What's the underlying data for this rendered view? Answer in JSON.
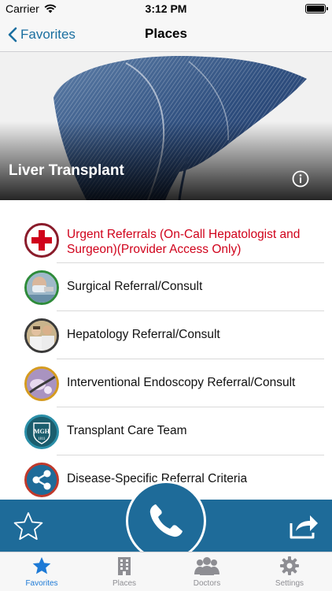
{
  "status_bar": {
    "carrier": "Carrier",
    "time": "3:12 PM"
  },
  "nav": {
    "back_label": "Favorites",
    "title": "Places"
  },
  "hero": {
    "title": "Liver Transplant"
  },
  "list": {
    "items": [
      {
        "label": "Urgent Referrals (On-Call Hepatologist and Surgeon)(Provider Access Only)",
        "icon": "red-cross-icon",
        "urgent": true
      },
      {
        "label": "Surgical Referral/Consult",
        "icon": "surgeon-photo"
      },
      {
        "label": "Hepatology Referral/Consult",
        "icon": "doctors-photo"
      },
      {
        "label": "Interventional Endoscopy Referral/Consult",
        "icon": "endoscopy-photo"
      },
      {
        "label": "Transplant Care Team",
        "icon": "mgh-logo"
      },
      {
        "label": "Disease-Specific Referral Criteria",
        "icon": "share-network-icon"
      }
    ]
  },
  "logo": {
    "text": "MGH",
    "year": "1811"
  },
  "tabs": [
    {
      "label": "Favorites",
      "icon": "star-icon",
      "active": true
    },
    {
      "label": "Places",
      "icon": "building-icon"
    },
    {
      "label": "Doctors",
      "icon": "people-icon"
    },
    {
      "label": "Settings",
      "icon": "gear-icon"
    }
  ],
  "colors": {
    "accent": "#1e6b99",
    "tint": "#1a6fa0",
    "urgent": "#d0021b",
    "active_tab": "#1d7ad6"
  }
}
